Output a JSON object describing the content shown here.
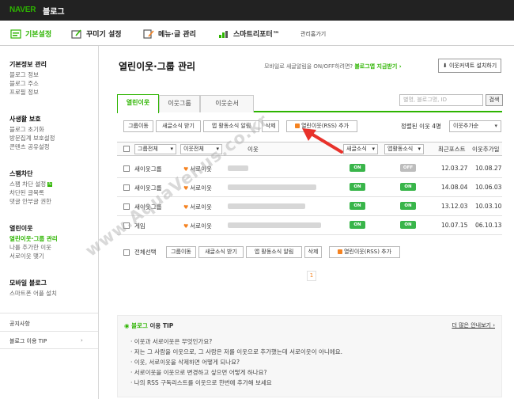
{
  "topbar": {
    "logo": "NAVER",
    "blog": "블로그"
  },
  "menu": [
    {
      "label": "기본설정"
    },
    {
      "label": "꾸미기 설정"
    },
    {
      "label": "메뉴·글 관리"
    },
    {
      "label": "스마트리포터™"
    },
    {
      "label": "관리홈가기"
    }
  ],
  "sidebar": {
    "groups": [
      {
        "title": "기본정보 관리",
        "items": [
          "블로그 정보",
          "블로그 주소",
          "프로필 정보"
        ]
      },
      {
        "title": "사생활 보호",
        "items": [
          "블로그 초기화",
          "방문집계 보호설정",
          "콘텐츠 공유설정"
        ]
      },
      {
        "title": "스팸차단",
        "items": [
          "스팸 차단 설정",
          "차단된 글목록",
          "댓글 안부글 권한"
        ]
      },
      {
        "title": "열린이웃",
        "items": [
          "열린이웃·그룹 관리",
          "나를 추가한 이웃",
          "서로이웃 맺기"
        ]
      },
      {
        "title": "모바일 블로그",
        "items": [
          "스마트폰 어플 설치"
        ]
      }
    ],
    "footer": [
      "공지사항",
      "블로그 이용 TIP"
    ]
  },
  "main": {
    "title": "열린이웃·그룹 관리",
    "help_text": "모바일로 새글알림을 ON/OFF하려면?",
    "help_link": "블로그앱 지금받기 ›",
    "install_button": "⬇ 이웃커넥트 설치하기",
    "tabs": [
      "열린이웃",
      "이웃그룹",
      "이웃순서"
    ],
    "search_placeholder": "별명, 블로그명, ID",
    "search_button": "검색",
    "toolbar": [
      "그룹이동",
      "새글소식 받기",
      "앱 활동소식 알림",
      "삭제",
      "열린이웃(RSS) 추가"
    ],
    "sort_label": "정렬된 이웃 4명",
    "sort_value": "이웃추가순",
    "columns": {
      "group": "그룹전체",
      "neighbor": "이웃전체",
      "name": "이웃",
      "news": "새글소식",
      "app": "앱활동소식",
      "recent": "최근포스트",
      "added": "이웃추가일"
    },
    "rows": [
      {
        "group": "새이웃그룹",
        "rel": "서로이웃",
        "news": "ON",
        "app": "OFF",
        "recent": "12.03.27",
        "added": "10.08.27"
      },
      {
        "group": "새이웃그룹",
        "rel": "서로이웃",
        "news": "ON",
        "app": "ON",
        "recent": "14.08.04",
        "added": "10.06.03"
      },
      {
        "group": "새이웃그룹",
        "rel": "서로이웃",
        "news": "ON",
        "app": "ON",
        "recent": "13.12.03",
        "added": "10.03.10"
      },
      {
        "group": "게임",
        "rel": "서로이웃",
        "news": "ON",
        "app": "ON",
        "recent": "10.07.15",
        "added": "06.10.13"
      }
    ],
    "bottom_toolbar": [
      "전체선택",
      "그룹이동",
      "새글소식 받기",
      "앱 활동소식 알림",
      "삭제",
      "열린이웃(RSS) 추가"
    ],
    "page": "1"
  },
  "tip": {
    "title_green": "블로그",
    "title_rest": " 이용 TIP",
    "more": "더 많은 안내보기 ›",
    "items": [
      "· 이웃과 서로이웃은 무엇인가요?",
      "· 저는 그 사람을 이웃으로, 그 사람은 저를 이웃으로 추가했는데 서로이웃이 아니에요.",
      "· 이웃, 서로이웃을 삭제하면 어떻게 되나요?",
      "· 서로이웃을 이웃으로 변경하고 싶으면 어떻게 하나요?",
      "· 나의 RSS 구독리스트를 이웃으로 한번에 추가해 보세요"
    ]
  },
  "watermark": "www.AquaVenus.co.kr",
  "colors": {
    "brand_green": "#2db400",
    "rss_orange": "#f58220",
    "arrow_red": "#e8322b"
  }
}
